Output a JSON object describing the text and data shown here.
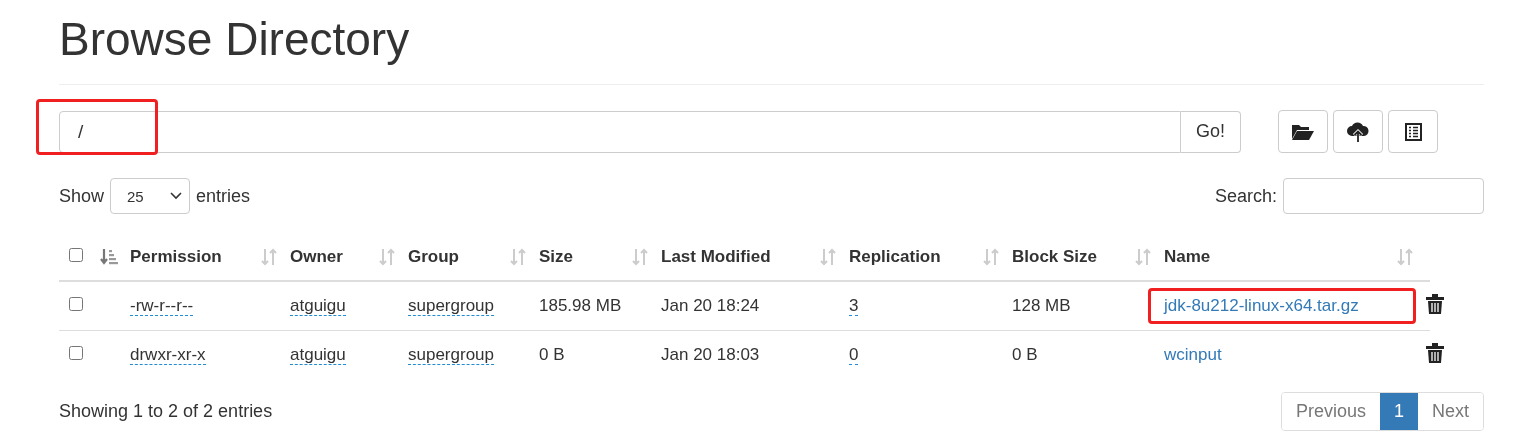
{
  "title": "Browse Directory",
  "path_bar": {
    "value": "/",
    "highlighted": true,
    "go_button": "Go!"
  },
  "length_menu": {
    "before": "Show",
    "value": "25",
    "after": "entries"
  },
  "search": {
    "label": "Search:"
  },
  "table": {
    "select_all_checked": false,
    "columns": [
      {
        "sorted": true
      },
      {
        "label": "Permission",
        "sorted": false
      },
      {
        "label": "Owner",
        "sorted": false
      },
      {
        "label": "Group",
        "sorted": false
      },
      {
        "label": "Size",
        "sorted": false
      },
      {
        "label": "Last Modified",
        "sorted": false
      },
      {
        "label": "Replication",
        "sorted": false
      },
      {
        "label": "Block Size",
        "sorted": false
      },
      {
        "label": "Name",
        "sorted": false
      }
    ],
    "rows": [
      {
        "checked": false,
        "permission": "-rw-r--r--",
        "owner": "atguigu",
        "group": "supergroup",
        "size": "185.98 MB",
        "modified": "Jan 20 18:24",
        "replication": "3",
        "block_size": "128 MB",
        "name": "jdk-8u212-linux-x64.tar.gz",
        "highlighted": true
      },
      {
        "checked": false,
        "permission": "drwxr-xr-x",
        "owner": "atguigu",
        "group": "supergroup",
        "size": "0 B",
        "modified": "Jan 20 18:03",
        "replication": "0",
        "block_size": "0 B",
        "name": "wcinput",
        "highlighted": false
      }
    ]
  },
  "info": "Showing 1 to 2 of 2 entries",
  "pagination": [
    {
      "label": "Previous",
      "selected": false,
      "disabled": true
    },
    {
      "label": "1",
      "selected": true,
      "disabled": false
    },
    {
      "label": "Next",
      "selected": false,
      "disabled": true
    }
  ]
}
